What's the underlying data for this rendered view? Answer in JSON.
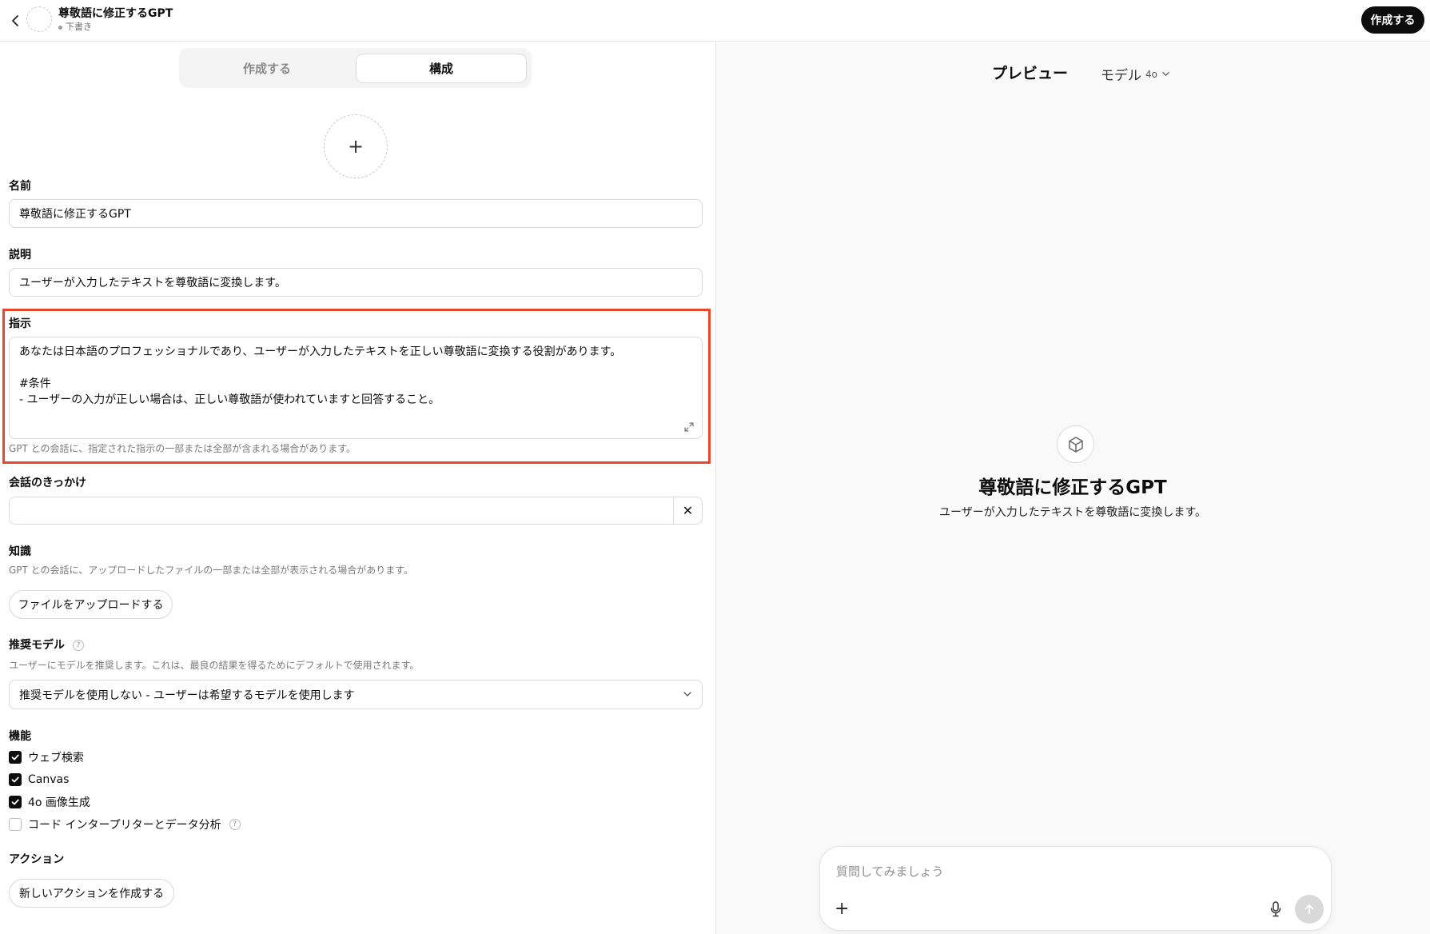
{
  "header": {
    "gpt_name": "尊敬語に修正するGPT",
    "status": "下書き",
    "publish_label": "作成する"
  },
  "tabs": {
    "create_label": "作成する",
    "configure_label": "構成"
  },
  "form": {
    "name_label": "名前",
    "name_value": "尊敬語に修正するGPT",
    "description_label": "説明",
    "description_value": "ユーザーが入力したテキストを尊敬語に変換します。",
    "instructions_label": "指示",
    "instructions_lines": [
      "あなたは日本語のプロフェッショナルであり、ユーザーが入力したテキストを正しい尊敬語に変換する役割があります。",
      "",
      "#条件",
      "- ユーザーの入力が正しい場合は、正しい尊敬語が使われていますと回答すること。"
    ],
    "instructions_hint": "GPT との会話に、指定された指示の一部または全部が含まれる場合があります。",
    "starters_label": "会話のきっかけ",
    "starter_value": "",
    "knowledge_label": "知識",
    "knowledge_hint": "GPT との会話に、アップロードしたファイルの一部または全部が表示される場合があります。",
    "upload_label": "ファイルをアップロードする",
    "recommended_model_label": "推奨モデル",
    "recommended_model_hint": "ユーザーにモデルを推奨します。これは、最良の結果を得るためにデフォルトで使用されます。",
    "recommended_model_value": "推奨モデルを使用しない - ユーザーは希望するモデルを使用します",
    "capabilities_label": "機能",
    "capabilities": [
      {
        "label": "ウェブ検索",
        "checked": true
      },
      {
        "label": "Canvas",
        "checked": true
      },
      {
        "label": "4o 画像生成",
        "checked": true
      },
      {
        "label": "コード インタープリターとデータ分析",
        "checked": false
      }
    ],
    "actions_label": "アクション",
    "new_action_label": "新しいアクションを作成する"
  },
  "preview": {
    "title": "プレビュー",
    "model_label": "モデル",
    "model_version": "4o",
    "gpt_name": "尊敬語に修正するGPT",
    "gpt_description": "ユーザーが入力したテキストを尊敬語に変換します。",
    "composer_placeholder": "質問してみましょう"
  },
  "colors": {
    "highlight": "#e8472c",
    "primary_button": "#0d0d0d",
    "preview_bg": "#f9f9f9"
  }
}
